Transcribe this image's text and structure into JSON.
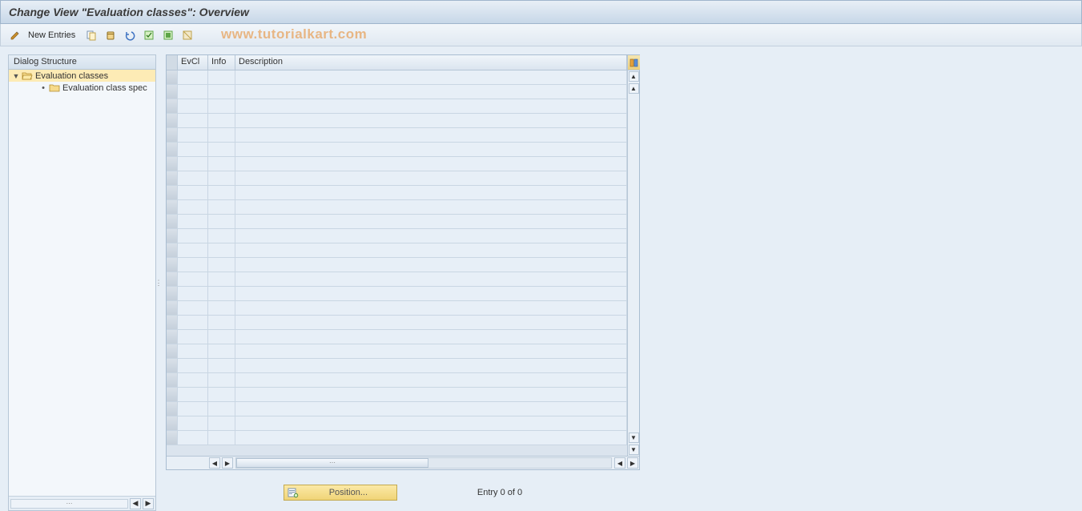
{
  "header": {
    "title": "Change View \"Evaluation classes\": Overview"
  },
  "toolbar": {
    "new_entries_label": "New Entries"
  },
  "watermark": "www.tutorialkart.com",
  "tree": {
    "header": "Dialog Structure",
    "items": [
      {
        "label": "Evaluation classes",
        "selected": true,
        "open": true
      },
      {
        "label": "Evaluation class spec",
        "selected": false,
        "open": false
      }
    ]
  },
  "table": {
    "columns": {
      "evcl": "EvCl",
      "info": "Info",
      "desc": "Description"
    },
    "rows_visible": 26
  },
  "footer": {
    "position_label": "Position...",
    "entry_text": "Entry 0 of 0"
  }
}
